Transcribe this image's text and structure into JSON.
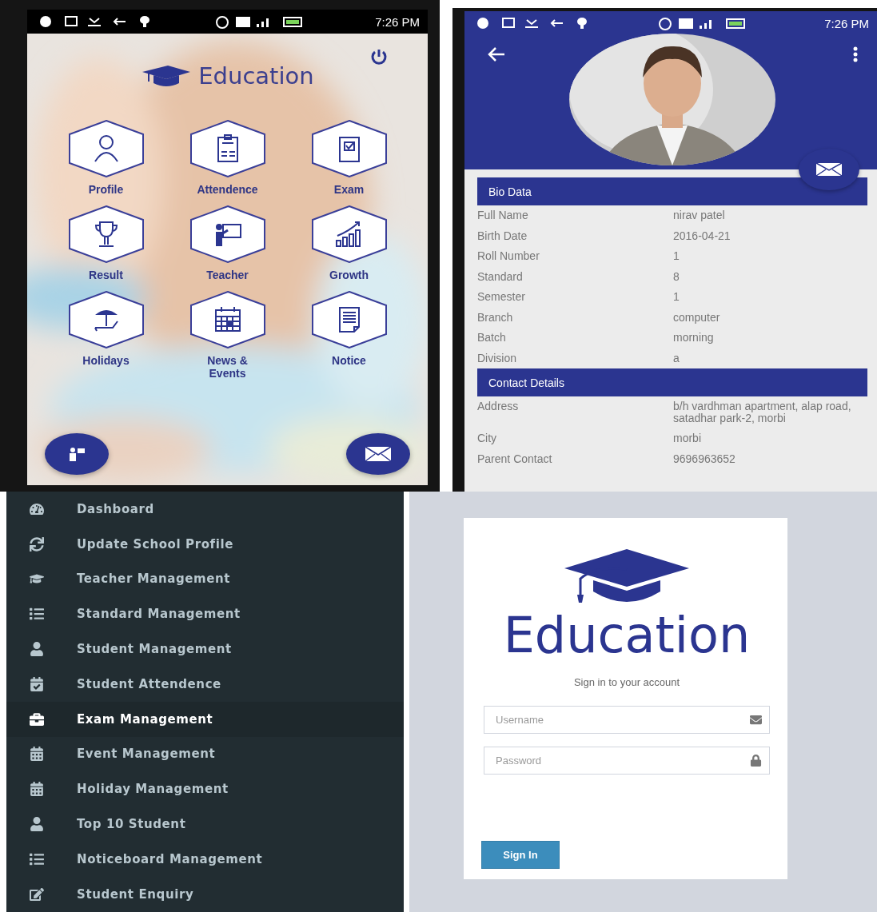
{
  "home_screen": {
    "status_bar": {
      "time": "7:26 PM"
    },
    "app_title": "Education",
    "tiles": [
      {
        "label": "Profile",
        "kind": "person"
      },
      {
        "label": "Attendence",
        "kind": "clipboard"
      },
      {
        "label": "Exam",
        "kind": "checklist"
      },
      {
        "label": "Result",
        "kind": "trophy"
      },
      {
        "label": "Teacher",
        "kind": "teacher"
      },
      {
        "label": "Growth",
        "kind": "growth"
      },
      {
        "label": "Holidays",
        "kind": "umbrella"
      },
      {
        "label": "News & Events",
        "kind": "calendar"
      },
      {
        "label": "Notice",
        "kind": "document"
      }
    ]
  },
  "profile_screen": {
    "status_bar": {
      "time": "7:26 PM"
    },
    "sections": [
      {
        "title": "Bio Data",
        "rows": [
          {
            "label": "Full Name",
            "value": "nirav patel"
          },
          {
            "label": "Birth Date",
            "value": "2016-04-21"
          },
          {
            "label": "Roll Number",
            "value": "1"
          },
          {
            "label": "Standard",
            "value": "8"
          },
          {
            "label": "Semester",
            "value": "1"
          },
          {
            "label": "Branch",
            "value": "computer"
          },
          {
            "label": "Batch",
            "value": "morning"
          },
          {
            "label": "Division",
            "value": "a"
          }
        ]
      },
      {
        "title": "Contact Details",
        "rows": [
          {
            "label": "Address",
            "value": "b/h vardhman apartment, alap road, satadhar park-2, morbi"
          },
          {
            "label": "City",
            "value": "morbi"
          },
          {
            "label": "Parent Contact",
            "value": "9696963652"
          }
        ]
      }
    ]
  },
  "admin_sidebar": {
    "items": [
      {
        "label": "Dashboard",
        "kind": "gauge",
        "selected": false
      },
      {
        "label": "Update School Profile",
        "kind": "refresh",
        "selected": false
      },
      {
        "label": "Teacher Management",
        "kind": "cap",
        "selected": false
      },
      {
        "label": "Standard Management",
        "kind": "list",
        "selected": false
      },
      {
        "label": "Student Management",
        "kind": "user",
        "selected": false
      },
      {
        "label": "Student Attendence",
        "kind": "calendar-check",
        "selected": false
      },
      {
        "label": "Exam Management",
        "kind": "briefcase",
        "selected": true
      },
      {
        "label": "Event Management",
        "kind": "calendar",
        "selected": false
      },
      {
        "label": "Holiday Management",
        "kind": "calendar",
        "selected": false
      },
      {
        "label": "Top 10 Student",
        "kind": "user",
        "selected": false
      },
      {
        "label": "Noticeboard Management",
        "kind": "list",
        "selected": false
      },
      {
        "label": "Student Enquiry",
        "kind": "edit",
        "selected": false
      }
    ]
  },
  "login": {
    "logo_text": "Education",
    "subtitle": "Sign in to your account",
    "username": {
      "placeholder": "Username"
    },
    "password": {
      "placeholder": "Password"
    },
    "button": "Sign In"
  }
}
